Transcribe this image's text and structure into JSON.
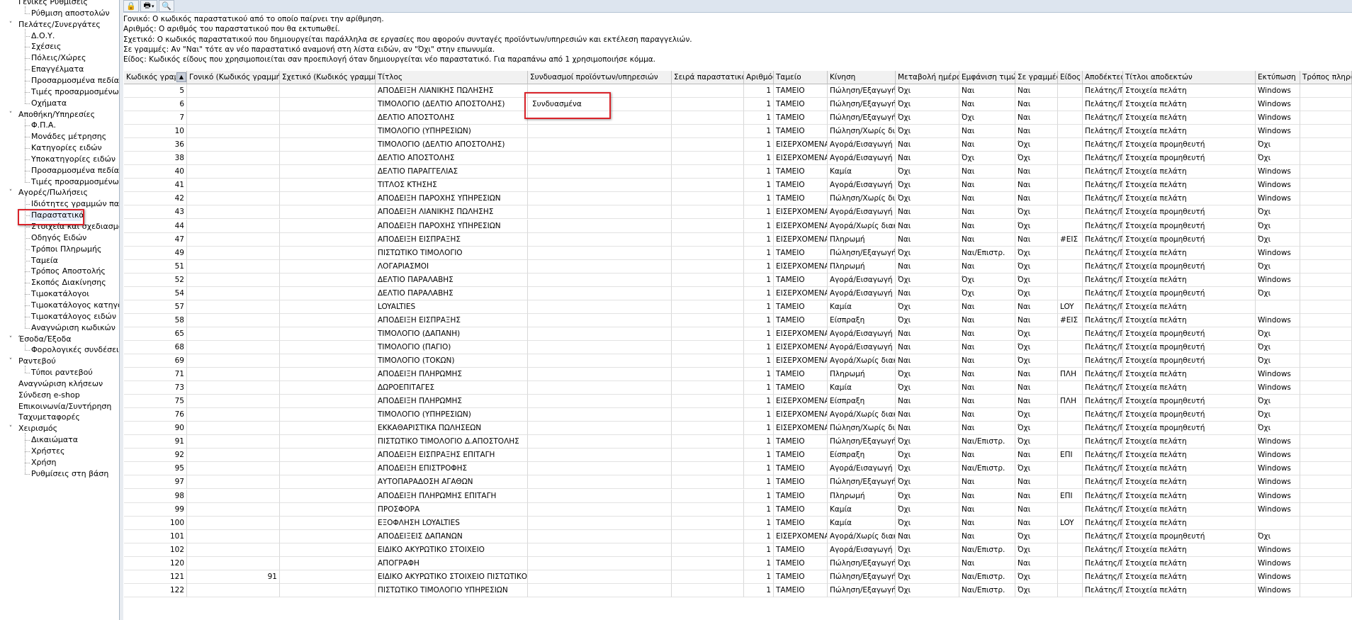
{
  "tree": [
    {
      "label": "Γενικές Ρυθμίσεις",
      "level": 0,
      "expanded": true
    },
    {
      "label": "Ρύθμιση αποστολών",
      "level": 1
    },
    {
      "label": "Πελάτες/Συνεργάτες",
      "level": 0,
      "expanded": true
    },
    {
      "label": "Δ.Ο.Υ.",
      "level": 1
    },
    {
      "label": "Σχέσεις",
      "level": 1
    },
    {
      "label": "Πόλεις/Χώρες",
      "level": 1
    },
    {
      "label": "Επαγγέλματα",
      "level": 1
    },
    {
      "label": "Προσαρμοσμένα πεδία",
      "level": 1
    },
    {
      "label": "Τιμές προσαρμοσμένων πεδίων",
      "level": 1
    },
    {
      "label": "Οχήματα",
      "level": 1
    },
    {
      "label": "Αποθήκη/Υπηρεσίες",
      "level": 0,
      "expanded": true
    },
    {
      "label": "Φ.Π.Α.",
      "level": 1
    },
    {
      "label": "Μονάδες μέτρησης",
      "level": 1
    },
    {
      "label": "Κατηγορίες ειδών",
      "level": 1
    },
    {
      "label": "Υποκατηγορίες ειδών",
      "level": 1
    },
    {
      "label": "Προσαρμοσμένα πεδία",
      "level": 1
    },
    {
      "label": "Τιμές προσαρμοσμένων πεδίων",
      "level": 1
    },
    {
      "label": "Αγορές/Πωλήσεις",
      "level": 0,
      "expanded": true
    },
    {
      "label": "Ιδιότητες γραμμών παραστατικών",
      "level": 1
    },
    {
      "label": "Παραστατικά",
      "level": 1,
      "selected": true
    },
    {
      "label": "Στοιχεία και σχεδιασμός παραστατικών",
      "level": 1
    },
    {
      "label": "Οδηγός Ειδών",
      "level": 1
    },
    {
      "label": "Τρόποι Πληρωμής",
      "level": 1
    },
    {
      "label": "Ταμεία",
      "level": 1
    },
    {
      "label": "Τρόπος Αποστολής",
      "level": 1
    },
    {
      "label": "Σκοπός Διακίνησης",
      "level": 1
    },
    {
      "label": "Τιμοκατάλογοι",
      "level": 1
    },
    {
      "label": "Τιμοκατάλογος κατηγοριών",
      "level": 1
    },
    {
      "label": "Τιμοκατάλογος ειδών",
      "level": 1
    },
    {
      "label": "Αναγνώριση κωδικών",
      "level": 1
    },
    {
      "label": "Έσοδα/Έξοδα",
      "level": 0,
      "expanded": true
    },
    {
      "label": "Φορολογικές συνδέσεις",
      "level": 1
    },
    {
      "label": "Ραντεβού",
      "level": 0,
      "expanded": true
    },
    {
      "label": "Τύποι ραντεβού",
      "level": 1
    },
    {
      "label": "Αναγνώριση κλήσεων",
      "level": 0
    },
    {
      "label": "Σύνδεση e-shop",
      "level": 0
    },
    {
      "label": "Επικοινωνία/Συντήρηση",
      "level": 0
    },
    {
      "label": "Ταχυμεταφορές",
      "level": 0
    },
    {
      "label": "Χειρισμός",
      "level": 0,
      "expanded": true
    },
    {
      "label": "Δικαιώματα",
      "level": 1
    },
    {
      "label": "Χρήστες",
      "level": 1
    },
    {
      "label": "Χρήση",
      "level": 1
    },
    {
      "label": "Ρυθμίσεις στη βάση",
      "level": 1
    }
  ],
  "toolbar": [
    {
      "name": "lock-icon",
      "glyph": "🔒"
    },
    {
      "name": "print-icon",
      "glyph": "🖶"
    },
    {
      "name": "search-icon",
      "glyph": "🔍"
    }
  ],
  "info": [
    "Γονικό: Ο κωδικός παραστατικού από το οποίο παίρνει την αρίθμηση.",
    "Αριθμός: Ο αριθμός του παραστατικού που θα εκτυπωθεί.",
    "Σχετικό: Ο κωδικός παραστατικού που δημιουργείται παράλληλα σε εργασίες που αφορούν συνταγές προϊόντων/υπηρεσιών και εκτέλεση παραγγελιών.",
    "Σε γραμμές: Αν \"Ναι\" τότε αν νέο παραστατικό αναμονή στη λίστα ειδών, αν \"Όχι\" στην επωνυμία.",
    "Είδος: Κωδικός είδους που χρησιμοποιείται σαν προεπιλογή όταν δημιουργείται νέο παραστατικό. Για παραπάνω από 1 χρησιμοποιήσε κόμμα."
  ],
  "columns": [
    "Κωδικός γραμμής",
    "Γονικό (Κωδικός γραμμής)",
    "Σχετικό (Κωδικός γραμμής)",
    "Τίτλος",
    "Συνδυασμοί προϊόντων/υπηρεσιών",
    "Σειρά παραστατικού",
    "Αριθμός",
    "Ταμείο",
    "Κίνηση",
    "Μεταβολή ημέρας",
    "Εμφάνιση τιμών",
    "Σε γραμμές",
    "Είδος",
    "Αποδέκτες",
    "Τίτλοι αποδεκτών",
    "Εκτύπωση",
    "Τρόπος πληρωμής"
  ],
  "rows": [
    [
      "5",
      "",
      "",
      "ΑΠΟΔΕΙΞΗ ΛΙΑΝΙΚΗΣ ΠΩΛΗΣΗΣ",
      "",
      "",
      "1",
      "ΤΑΜΕΙΟ",
      "Πώληση/Εξαγωγή",
      "Όχι",
      "Ναι",
      "Ναι",
      "",
      "Πελάτης/Πρ",
      "Στοιχεία πελάτη",
      "Windows",
      ""
    ],
    [
      "6",
      "",
      "",
      "ΤΙΜΟΛΟΓΙΟ (ΔΕΛΤΙΟ ΑΠΟΣΤΟΛΗΣ)",
      "Συνδυασμένα",
      "",
      "1",
      "ΤΑΜΕΙΟ",
      "Πώληση/Εξαγωγή",
      "Όχι",
      "Ναι",
      "Ναι",
      "",
      "Πελάτης/Πρ",
      "Στοιχεία πελάτη",
      "Windows",
      ""
    ],
    [
      "7",
      "",
      "",
      "ΔΕΛΤΙΟ ΑΠΟΣΤΟΛΗΣ",
      "",
      "",
      "1",
      "ΤΑΜΕΙΟ",
      "Πώληση/Εξαγωγή",
      "Όχι",
      "Όχι",
      "Ναι",
      "",
      "Πελάτης/Πρ",
      "Στοιχεία πελάτη",
      "Windows",
      ""
    ],
    [
      "10",
      "",
      "",
      "ΤΙΜΟΛΟΓΙΟ (ΥΠΗΡΕΣΙΩΝ)",
      "",
      "",
      "1",
      "ΤΑΜΕΙΟ",
      "Πώληση/Χωρίς διακίνηση",
      "Όχι",
      "Ναι",
      "Ναι",
      "",
      "Πελάτης/Πρ",
      "Στοιχεία πελάτη",
      "Windows",
      ""
    ],
    [
      "36",
      "",
      "",
      "ΤΙΜΟΛΟΓΙΟ (ΔΕΛΤΙΟ ΑΠΟΣΤΟΛΗΣ)",
      "",
      "",
      "1",
      "ΕΙΣΕΡΧΟΜΕΝΑ",
      "Αγορά/Εισαγωγή",
      "Ναι",
      "Ναι",
      "Όχι",
      "",
      "Πελάτης/Πρ",
      "Στοιχεία προμηθευτή",
      "Όχι",
      ""
    ],
    [
      "38",
      "",
      "",
      "ΔΕΛΤΙΟ ΑΠΟΣΤΟΛΗΣ",
      "",
      "",
      "1",
      "ΕΙΣΕΡΧΟΜΕΝΑ",
      "Αγορά/Εισαγωγή",
      "Ναι",
      "Όχι",
      "Όχι",
      "",
      "Πελάτης/Πρ",
      "Στοιχεία προμηθευτή",
      "Όχι",
      ""
    ],
    [
      "40",
      "",
      "",
      "ΔΕΛΤΙΟ ΠΑΡΑΓΓΕΛΙΑΣ",
      "",
      "",
      "1",
      "ΤΑΜΕΙΟ",
      "Καμία",
      "Όχι",
      "Ναι",
      "Ναι",
      "",
      "Πελάτης/Πρ",
      "Στοιχεία πελάτη",
      "Windows",
      ""
    ],
    [
      "41",
      "",
      "",
      "ΤΙΤΛΟΣ ΚΤΗΣΗΣ",
      "",
      "",
      "1",
      "ΤΑΜΕΙΟ",
      "Αγορά/Εισαγωγή",
      "Όχι",
      "Ναι",
      "Ναι",
      "",
      "Πελάτης/Πρ",
      "Στοιχεία πελάτη",
      "Windows",
      ""
    ],
    [
      "42",
      "",
      "",
      "ΑΠΟΔΕΙΞΗ ΠΑΡΟΧΗΣ ΥΠΗΡΕΣΙΩΝ",
      "",
      "",
      "1",
      "ΤΑΜΕΙΟ",
      "Πώληση/Χωρίς διακίνηση",
      "Όχι",
      "Ναι",
      "Ναι",
      "",
      "Πελάτης/Πρ",
      "Στοιχεία πελάτη",
      "Windows",
      ""
    ],
    [
      "43",
      "",
      "",
      "ΑΠΟΔΕΙΞΗ ΛΙΑΝΙΚΗΣ ΠΩΛΗΣΗΣ",
      "",
      "",
      "1",
      "ΕΙΣΕΡΧΟΜΕΝΑ",
      "Αγορά/Εισαγωγή",
      "Ναι",
      "Ναι",
      "Όχι",
      "",
      "Πελάτης/Πρ",
      "Στοιχεία προμηθευτή",
      "Όχι",
      ""
    ],
    [
      "44",
      "",
      "",
      "ΑΠΟΔΕΙΞΗ ΠΑΡΟΧΗΣ ΥΠΗΡΕΣΙΩΝ",
      "",
      "",
      "1",
      "ΕΙΣΕΡΧΟΜΕΝΑ",
      "Αγορά/Χωρίς διακίνηση",
      "Ναι",
      "Ναι",
      "Όχι",
      "",
      "Πελάτης/Πρ",
      "Στοιχεία προμηθευτή",
      "Όχι",
      ""
    ],
    [
      "47",
      "",
      "",
      "ΑΠΟΔΕΙΞΗ ΕΙΣΠΡΑΞΗΣ",
      "",
      "",
      "1",
      "ΕΙΣΕΡΧΟΜΕΝΑ",
      "Πληρωμή",
      "Ναι",
      "Ναι",
      "Ναι",
      "#ΕΙΣ",
      "Πελάτης/Πρ",
      "Στοιχεία προμηθευτή",
      "Όχι",
      ""
    ],
    [
      "49",
      "",
      "",
      "ΠΙΣΤΩΤΙΚΟ ΤΙΜΟΛΟΓΙΟ",
      "",
      "",
      "1",
      "ΤΑΜΕΙΟ",
      "Πώληση/Εξαγωγή",
      "Όχι",
      "Ναι/Επιστρ.",
      "Όχι",
      "",
      "Πελάτης/Πρ",
      "Στοιχεία πελάτη",
      "Windows",
      ""
    ],
    [
      "51",
      "",
      "",
      "ΛΟΓΑΡΙΑΣΜΟΙ",
      "",
      "",
      "1",
      "ΕΙΣΕΡΧΟΜΕΝΑ",
      "Πληρωμή",
      "Ναι",
      "Ναι",
      "Όχι",
      "",
      "Πελάτης/Πρ",
      "Στοιχεία προμηθευτή",
      "Όχι",
      ""
    ],
    [
      "52",
      "",
      "",
      "ΔΕΛΤΙΟ ΠΑΡΑΛΑΒΗΣ",
      "",
      "",
      "1",
      "ΤΑΜΕΙΟ",
      "Αγορά/Εισαγωγή",
      "Όχι",
      "Όχι",
      "Όχι",
      "",
      "Πελάτης/Πρ",
      "Στοιχεία πελάτη",
      "Windows",
      ""
    ],
    [
      "54",
      "",
      "",
      "ΔΕΛΤΙΟ ΠΑΡΑΛΑΒΗΣ",
      "",
      "",
      "1",
      "ΕΙΣΕΡΧΟΜΕΝΑ",
      "Αγορά/Εισαγωγή",
      "Ναι",
      "Όχι",
      "Όχι",
      "",
      "Πελάτης/Πρ",
      "Στοιχεία προμηθευτή",
      "Όχι",
      ""
    ],
    [
      "57",
      "",
      "",
      "LOYALTIES",
      "",
      "",
      "1",
      "ΤΑΜΕΙΟ",
      "Καμία",
      "Όχι",
      "Ναι",
      "Ναι",
      "LOY",
      "Πελάτης/Πρ",
      "Στοιχεία πελάτη",
      "",
      ""
    ],
    [
      "58",
      "",
      "",
      "ΑΠΟΔΕΙΞΗ ΕΙΣΠΡΑΞΗΣ",
      "",
      "",
      "1",
      "ΤΑΜΕΙΟ",
      "Είσπραξη",
      "Όχι",
      "Ναι",
      "Ναι",
      "#ΕΙΣ",
      "Πελάτης/Πρ",
      "Στοιχεία πελάτη",
      "Windows",
      ""
    ],
    [
      "65",
      "",
      "",
      "ΤΙΜΟΛΟΓΙΟ (ΔΑΠΑΝΗ)",
      "",
      "",
      "1",
      "ΕΙΣΕΡΧΟΜΕΝΑ",
      "Αγορά/Εισαγωγή",
      "Ναι",
      "Ναι",
      "Όχι",
      "",
      "Πελάτης/Πρ",
      "Στοιχεία προμηθευτή",
      "Όχι",
      ""
    ],
    [
      "68",
      "",
      "",
      "ΤΙΜΟΛΟΓΙΟ (ΠΑΓΙΟ)",
      "",
      "",
      "1",
      "ΕΙΣΕΡΧΟΜΕΝΑ",
      "Αγορά/Εισαγωγή",
      "Ναι",
      "Ναι",
      "Όχι",
      "",
      "Πελάτης/Πρ",
      "Στοιχεία προμηθευτή",
      "Όχι",
      ""
    ],
    [
      "69",
      "",
      "",
      "ΤΙΜΟΛΟΓΙΟ (ΤΟΚΩΝ)",
      "",
      "",
      "1",
      "ΕΙΣΕΡΧΟΜΕΝΑ",
      "Αγορά/Χωρίς διακίνηση",
      "Ναι",
      "Ναι",
      "Όχι",
      "",
      "Πελάτης/Πρ",
      "Στοιχεία προμηθευτή",
      "Όχι",
      ""
    ],
    [
      "71",
      "",
      "",
      "ΑΠΟΔΕΙΞΗ ΠΛΗΡΩΜΗΣ",
      "",
      "",
      "1",
      "ΤΑΜΕΙΟ",
      "Πληρωμή",
      "Όχι",
      "Ναι",
      "Ναι",
      "ΠΛΗ",
      "Πελάτης/Πρ",
      "Στοιχεία πελάτη",
      "Windows",
      ""
    ],
    [
      "73",
      "",
      "",
      "ΔΩΡΟΕΠΙΤΑΓΕΣ",
      "",
      "",
      "1",
      "ΤΑΜΕΙΟ",
      "Καμία",
      "Όχι",
      "Ναι",
      "Ναι",
      "",
      "Πελάτης/Πρ",
      "Στοιχεία πελάτη",
      "Windows",
      ""
    ],
    [
      "75",
      "",
      "",
      "ΑΠΟΔΕΙΞΗ ΠΛΗΡΩΜΗΣ",
      "",
      "",
      "1",
      "ΕΙΣΕΡΧΟΜΕΝΑ",
      "Είσπραξη",
      "Ναι",
      "Ναι",
      "Ναι",
      "ΠΛΗ",
      "Πελάτης/Πρ",
      "Στοιχεία προμηθευτή",
      "Όχι",
      ""
    ],
    [
      "76",
      "",
      "",
      "ΤΙΜΟΛΟΓΙΟ (ΥΠΗΡΕΣΙΩΝ)",
      "",
      "",
      "1",
      "ΕΙΣΕΡΧΟΜΕΝΑ",
      "Αγορά/Χωρίς διακίνηση",
      "Ναι",
      "Ναι",
      "Όχι",
      "",
      "Πελάτης/Πρ",
      "Στοιχεία προμηθευτή",
      "Όχι",
      ""
    ],
    [
      "90",
      "",
      "",
      "ΕΚΚΑΘΑΡΙΣΤΙΚΑ ΠΩΛΗΣΕΩΝ",
      "",
      "",
      "1",
      "ΕΙΣΕΡΧΟΜΕΝΑ",
      "Πώληση/Χωρίς διακίνηση",
      "Ναι",
      "Ναι",
      "Όχι",
      "",
      "Πελάτης/Πρ",
      "Στοιχεία προμηθευτή",
      "Όχι",
      ""
    ],
    [
      "91",
      "",
      "",
      "ΠΙΣΤΩΤΙΚΟ ΤΙΜΟΛΟΓΙΟ Δ.ΑΠΟΣΤΟΛΗΣ",
      "",
      "",
      "1",
      "ΤΑΜΕΙΟ",
      "Πώληση/Εξαγωγή",
      "Όχι",
      "Ναι/Επιστρ.",
      "Όχι",
      "",
      "Πελάτης/Πρ",
      "Στοιχεία πελάτη",
      "Windows",
      ""
    ],
    [
      "92",
      "",
      "",
      "ΑΠΟΔΕΙΞΗ ΕΙΣΠΡΑΞΗΣ ΕΠΙΤΑΓΗ",
      "",
      "",
      "1",
      "ΤΑΜΕΙΟ",
      "Είσπραξη",
      "Όχι",
      "Ναι",
      "Ναι",
      "ΕΠΙ",
      "Πελάτης/Πρ",
      "Στοιχεία πελάτη",
      "Windows",
      ""
    ],
    [
      "95",
      "",
      "",
      "ΑΠΟΔΕΙΞΗ ΕΠΙΣΤΡΟΦΗΣ",
      "",
      "",
      "1",
      "ΤΑΜΕΙΟ",
      "Αγορά/Εισαγωγή",
      "Όχι",
      "Ναι/Επιστρ.",
      "Όχι",
      "",
      "Πελάτης/Πρ",
      "Στοιχεία πελάτη",
      "Windows",
      ""
    ],
    [
      "97",
      "",
      "",
      "ΑΥΤΟΠΑΡΑΔΟΣΗ ΑΓΑΘΩΝ",
      "",
      "",
      "1",
      "ΤΑΜΕΙΟ",
      "Πώληση/Εξαγωγή",
      "Όχι",
      "Ναι",
      "Ναι",
      "",
      "Πελάτης/Πρ",
      "Στοιχεία πελάτη",
      "Windows",
      ""
    ],
    [
      "98",
      "",
      "",
      "ΑΠΟΔΕΙΞΗ ΠΛΗΡΩΜΗΣ ΕΠΙΤΑΓΗ",
      "",
      "",
      "1",
      "ΤΑΜΕΙΟ",
      "Πληρωμή",
      "Όχι",
      "Ναι",
      "Ναι",
      "ΕΠΙ",
      "Πελάτης/Πρ",
      "Στοιχεία πελάτη",
      "Windows",
      ""
    ],
    [
      "99",
      "",
      "",
      "ΠΡΟΣΦΟΡΑ",
      "",
      "",
      "1",
      "ΤΑΜΕΙΟ",
      "Καμία",
      "Όχι",
      "Ναι",
      "Ναι",
      "",
      "Πελάτης/Πρ",
      "Στοιχεία πελάτη",
      "Windows",
      ""
    ],
    [
      "100",
      "",
      "",
      "ΕΞΟΦΛΗΣΗ LOYALTIES",
      "",
      "",
      "1",
      "ΤΑΜΕΙΟ",
      "Καμία",
      "Όχι",
      "Ναι",
      "Ναι",
      "LOY",
      "Πελάτης/Πρ",
      "Στοιχεία πελάτη",
      "",
      ""
    ],
    [
      "101",
      "",
      "",
      "ΑΠΟΔΕΙΞΕΙΣ ΔΑΠΑΝΩΝ",
      "",
      "",
      "1",
      "ΕΙΣΕΡΧΟΜΕΝΑ",
      "Αγορά/Χωρίς διακίνηση",
      "Ναι",
      "Ναι",
      "Όχι",
      "",
      "Πελάτης/Πρ",
      "Στοιχεία προμηθευτή",
      "Όχι",
      ""
    ],
    [
      "102",
      "",
      "",
      "ΕΙΔΙΚΟ ΑΚΥΡΩΤΙΚΟ ΣΤΟΙΧΕΙΟ",
      "",
      "",
      "1",
      "ΤΑΜΕΙΟ",
      "Αγορά/Εισαγωγή",
      "Όχι",
      "Ναι/Επιστρ.",
      "Όχι",
      "",
      "Πελάτης/Πρ",
      "Στοιχεία πελάτη",
      "Windows",
      ""
    ],
    [
      "120",
      "",
      "",
      "ΑΠΟΓΡΑΦΗ",
      "",
      "",
      "1",
      "ΤΑΜΕΙΟ",
      "Πώληση/Εξαγωγή",
      "Όχι",
      "Ναι",
      "Ναι",
      "",
      "Πελάτης/Πρ",
      "Στοιχεία πελάτη",
      "Windows",
      ""
    ],
    [
      "121",
      "91",
      "",
      "ΕΙΔΙΚΟ ΑΚΥΡΩΤΙΚΟ ΣΤΟΙΧΕΙΟ ΠΙΣΤΩΤΙΚΟ",
      "",
      "",
      "1",
      "ΤΑΜΕΙΟ",
      "Πώληση/Εξαγωγή",
      "Όχι",
      "Ναι/Επιστρ.",
      "Όχι",
      "",
      "Πελάτης/Πρ",
      "Στοιχεία πελάτη",
      "Windows",
      ""
    ],
    [
      "122",
      "",
      "",
      "ΠΙΣΤΩΤΙΚΟ ΤΙΜΟΛΟΓΙΟ ΥΠΗΡΕΣΙΩΝ",
      "",
      "",
      "1",
      "ΤΑΜΕΙΟ",
      "Πώληση/Εξαγωγή",
      "Όχι",
      "Ναι/Επιστρ.",
      "Όχι",
      "",
      "Πελάτης/Πρ",
      "Στοιχεία πελάτη",
      "Windows",
      ""
    ]
  ],
  "sort_icon": "sort-ascending-icon",
  "highlight_color": "#d9232a"
}
